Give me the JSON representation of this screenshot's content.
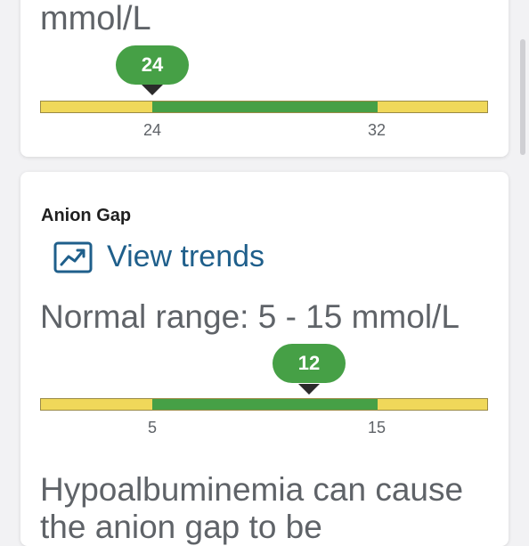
{
  "top_card": {
    "unit_text": "mmol/L",
    "value": 24,
    "marker_label": "24",
    "range_low": 24,
    "range_high": 32,
    "tick_low": "24",
    "tick_high": "32"
  },
  "anion_gap": {
    "title": "Anion Gap",
    "trends_label": "View trends",
    "trends_icon": "trend-chart-icon",
    "normal_range_text": "Normal range: 5 - 15 mmol/L",
    "value": 12,
    "marker_label": "12",
    "range_low": 5,
    "range_high": 15,
    "tick_low": "5",
    "tick_high": "15",
    "hint_text": "Hypoalbuminemia can cause the anion gap to be"
  },
  "colors": {
    "normal": "#46a046",
    "out_of_range": "#f0d85a",
    "link": "#1f5f8b",
    "muted_text": "#5f6368"
  }
}
